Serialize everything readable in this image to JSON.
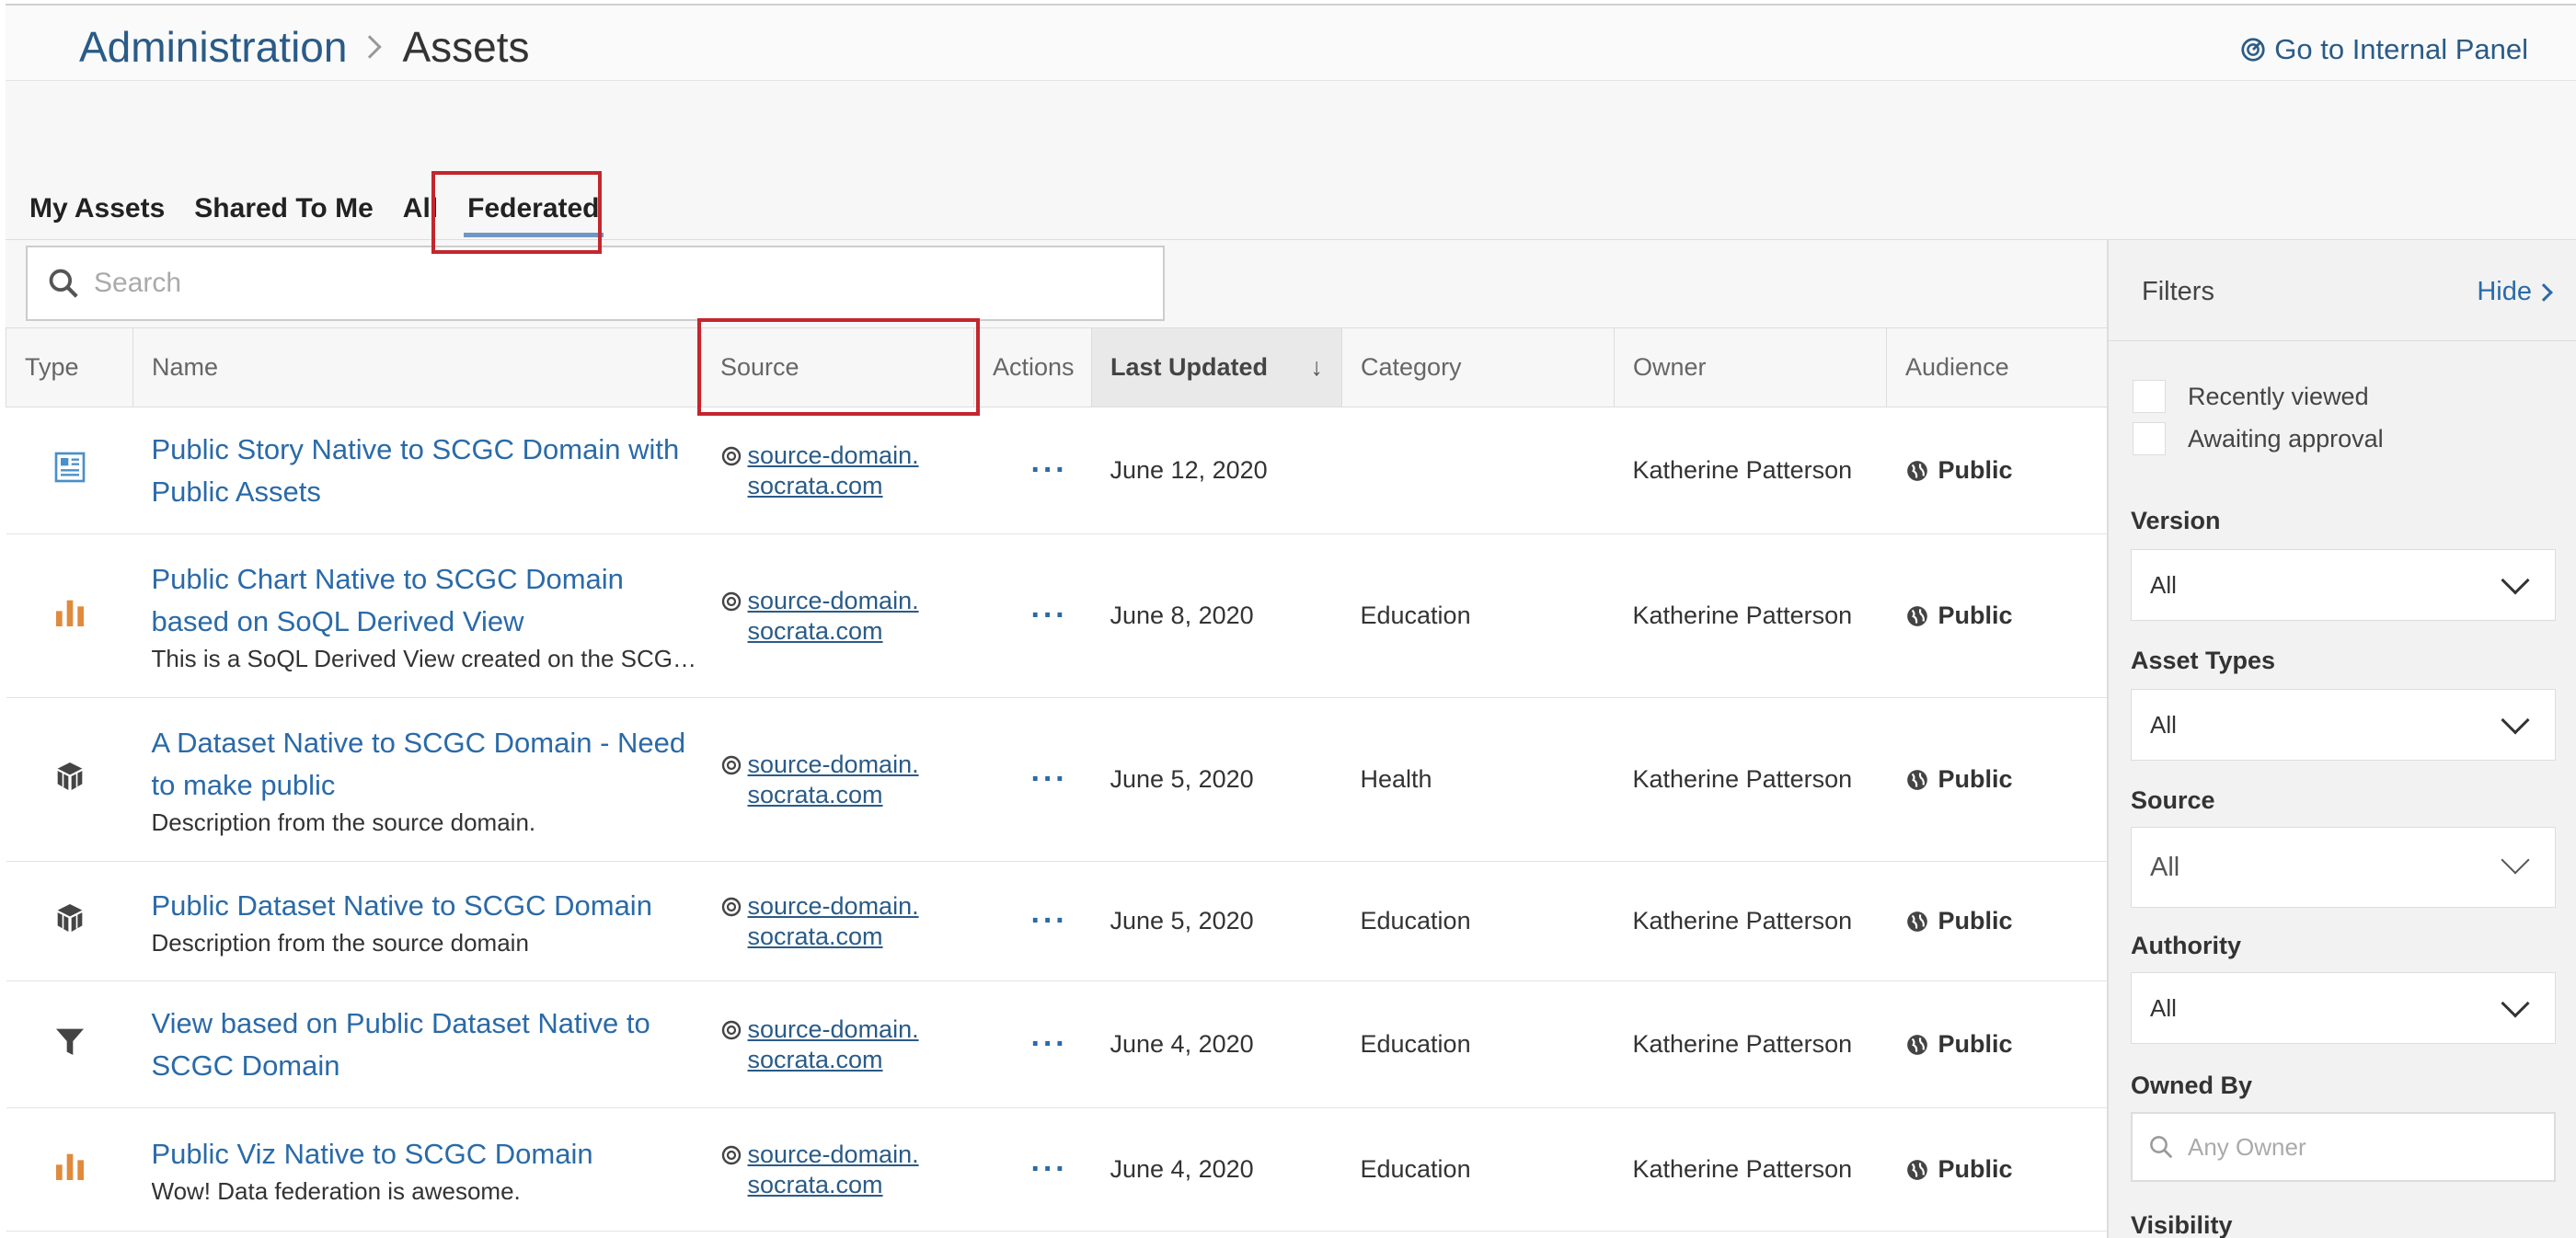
{
  "header": {
    "breadcrumb_root": "Administration",
    "breadcrumb_current": "Assets",
    "internal_panel_label": "Go to Internal Panel"
  },
  "tabs": [
    "My Assets",
    "Shared To Me",
    "All",
    "Federated"
  ],
  "active_tab": "Federated",
  "search": {
    "placeholder": "Search"
  },
  "table": {
    "columns": [
      "Type",
      "Name",
      "Source",
      "Actions",
      "Last Updated",
      "Category",
      "Owner",
      "Audience"
    ],
    "sort_arrow": "↓",
    "rows": [
      {
        "type_icon": "story-icon",
        "title": "Public Story Native to SCGC Domain with Public Assets",
        "description": "",
        "source_line1": "source-domain.",
        "source_line2": "socrata.com",
        "actions": "···",
        "updated": "June 12, 2020",
        "category": "",
        "owner": "Katherine Patterson",
        "audience": "Public"
      },
      {
        "type_icon": "bar-chart-icon",
        "title": "Public Chart Native to SCGC Domain based on SoQL Derived View",
        "description": "This is a SoQL Derived View created on the SCGC domain",
        "source_line1": "source-domain.",
        "source_line2": "socrata.com",
        "actions": "···",
        "updated": "June 8, 2020",
        "category": "Education",
        "owner": "Katherine Patterson",
        "audience": "Public"
      },
      {
        "type_icon": "dataset-icon",
        "title": "A Dataset Native to SCGC Domain - Need to make public",
        "description": "Description from the source domain.",
        "source_line1": "source-domain.",
        "source_line2": "socrata.com",
        "actions": "···",
        "updated": "June 5, 2020",
        "category": "Health",
        "owner": "Katherine Patterson",
        "audience": "Public"
      },
      {
        "type_icon": "dataset-icon",
        "title": "Public Dataset Native to SCGC Domain",
        "description": "Description from the source domain",
        "source_line1": "source-domain.",
        "source_line2": "socrata.com",
        "actions": "···",
        "updated": "June 5, 2020",
        "category": "Education",
        "owner": "Katherine Patterson",
        "audience": "Public"
      },
      {
        "type_icon": "filter-icon",
        "title": "View based on Public Dataset Native to SCGC Domain",
        "description": "",
        "source_line1": "source-domain.",
        "source_line2": "socrata.com",
        "actions": "···",
        "updated": "June 4, 2020",
        "category": "Education",
        "owner": "Katherine Patterson",
        "audience": "Public"
      },
      {
        "type_icon": "bar-chart-icon",
        "title": "Public Viz Native to SCGC Domain",
        "description": "Wow! Data federation is awesome.",
        "source_line1": "source-domain.",
        "source_line2": "socrata.com",
        "actions": "···",
        "updated": "June 4, 2020",
        "category": "Education",
        "owner": "Katherine Patterson",
        "audience": "Public"
      }
    ]
  },
  "filters": {
    "title": "Filters",
    "hide_label": "Hide",
    "recently_viewed": "Recently viewed",
    "awaiting_approval": "Awaiting approval",
    "version_label": "Version",
    "version_value": "All",
    "asset_types_label": "Asset Types",
    "asset_types_value": "All",
    "source_label": "Source",
    "source_value": "All",
    "authority_label": "Authority",
    "authority_value": "All",
    "owned_by_label": "Owned By",
    "owned_by_placeholder": "Any Owner",
    "visibility_label": "Visibility"
  },
  "colors": {
    "link": "#2a6aa8",
    "highlight_box": "#c4262e",
    "chart_icon": "#e08a3c",
    "tab_underline": "#6e97c6"
  }
}
